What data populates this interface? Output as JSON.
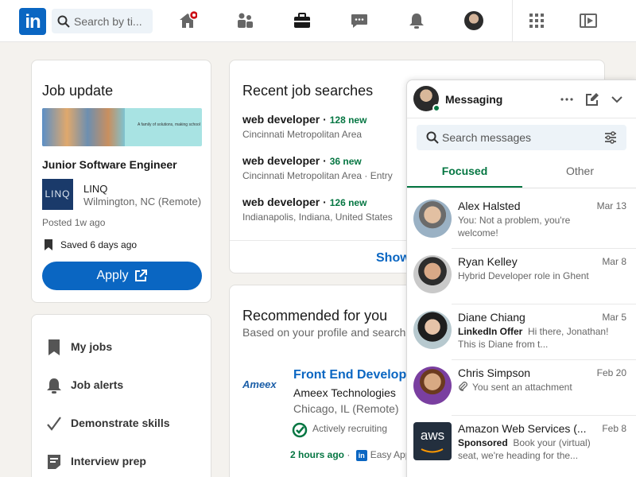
{
  "nav": {
    "logo": "in",
    "search_placeholder": "Search by ti..."
  },
  "job_update": {
    "title": "Job update",
    "banner_text": "A family of solutions, making school",
    "job_title": "Junior Software Engineer",
    "company_logo": "LINQ",
    "company": "LINQ",
    "location": "Wilmington, NC (Remote)",
    "posted": "Posted 1w ago",
    "saved": "Saved 6 days ago",
    "apply": "Apply"
  },
  "links": [
    {
      "label": "My jobs",
      "icon": "bookmark-icon"
    },
    {
      "label": "Job alerts",
      "icon": "bell-icon"
    },
    {
      "label": "Demonstrate skills",
      "icon": "checkmark-icon"
    },
    {
      "label": "Interview prep",
      "icon": "clipboard-icon"
    }
  ],
  "recent": {
    "title": "Recent job searches",
    "searches": [
      {
        "query": "web developer",
        "count": "128 new",
        "location": "Cincinnati Metropolitan Area"
      },
      {
        "query": "web developer",
        "count": "36 new",
        "location": "Cincinnati Metropolitan Area · Entry"
      },
      {
        "query": "web developer",
        "count": "126 new",
        "location": "Indianapolis, Indiana, United States"
      }
    ],
    "show_more": "Show"
  },
  "recommended": {
    "title": "Recommended for you",
    "subtitle": "Based on your profile and search",
    "company_logo": "Ameex",
    "job_title": "Front End Develope",
    "company": "Ameex Technologies",
    "location": "Chicago, IL (Remote)",
    "recruiting": "Actively recruiting",
    "time": "2 hours ago",
    "easy_apply": "Easy App"
  },
  "messaging": {
    "title": "Messaging",
    "search_placeholder": "Search messages",
    "tabs": [
      "Focused",
      "Other"
    ],
    "conversations": [
      {
        "name": "Alex Halsted",
        "date": "Mar 13",
        "snippet": "You: Not a problem, you're welcome!"
      },
      {
        "name": "Ryan Kelley",
        "date": "Mar 8",
        "snippet": "Hybrid Developer role in Ghent"
      },
      {
        "name": "Diane Chiang",
        "date": "Mar 5",
        "tag": "LinkedIn Offer",
        "snippet": "Hi there, Jonathan! This is Diane from t..."
      },
      {
        "name": "Chris Simpson",
        "date": "Feb 20",
        "snippet": "You sent an attachment"
      },
      {
        "name": "Amazon Web Services (...",
        "date": "Feb 8",
        "tag": "Sponsored",
        "snippet": "Book your (virtual) seat, we're heading for the...",
        "avatar_text": "aws"
      }
    ]
  }
}
